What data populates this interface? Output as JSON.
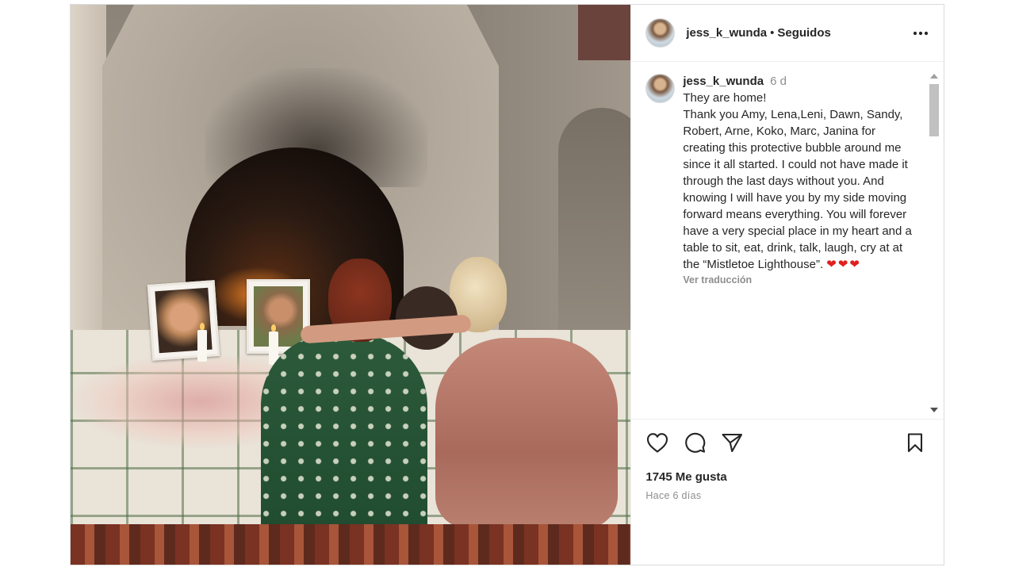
{
  "post": {
    "author": "jess_k_wunda",
    "separator": "•",
    "follow_status": "Seguidos",
    "caption": {
      "username": "jess_k_wunda",
      "time": "6 d",
      "text": "They are home!\nThank you Amy, Lena,Leni, Dawn, Sandy, Robert, Arne, Koko, Marc, Janina for creating this protective bubble around me since it all started. I could not have made it through the last days without you. And knowing I will have you by my side moving forward means everything. You will forever have a very special place in my heart and a table to sit, eat, drink, talk, laugh, cry at at the “Mistletoe Lighthouse”.",
      "hearts": "❤❤❤",
      "translate_label": "Ver traducción"
    },
    "likes_count": "1745",
    "likes_label": "Me gusta",
    "posted_ago": "Hace 6 días"
  },
  "icons": {
    "more": "more-options-icon",
    "like": "heart-icon",
    "comment": "comment-icon",
    "share": "share-icon",
    "save": "bookmark-icon"
  },
  "colors": {
    "text": "#262626",
    "secondary": "#8e8e8e",
    "border": "#dbdbdb",
    "heart_emoji": "#e0201f"
  }
}
